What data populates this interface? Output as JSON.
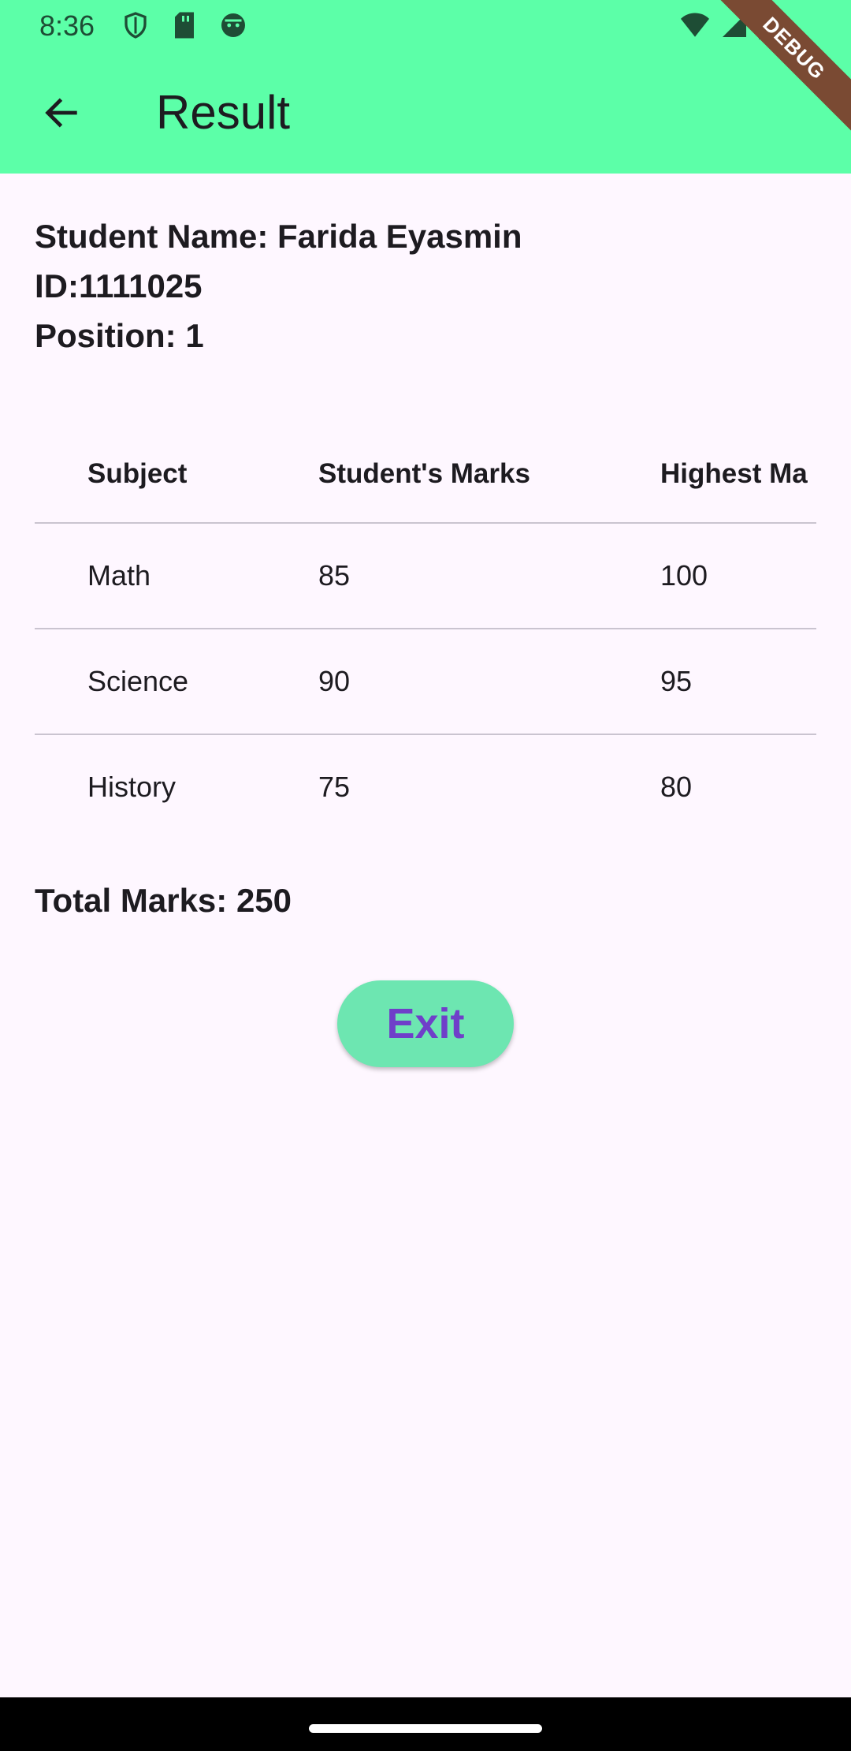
{
  "status_bar": {
    "time": "8:36"
  },
  "app_bar": {
    "title": "Result",
    "debug_banner": "DEBUG"
  },
  "student": {
    "name_line": "Student Name: Farida Eyasmin",
    "id_line": "ID:1111025",
    "position_line": "Position: 1"
  },
  "table": {
    "headers": [
      "Subject",
      "Student's Marks",
      "Highest Ma"
    ],
    "rows": [
      [
        "Math",
        "85",
        "100"
      ],
      [
        "Science",
        "90",
        "95"
      ],
      [
        "History",
        "75",
        "80"
      ]
    ]
  },
  "total_line": "Total Marks: 250",
  "exit_button": "Exit",
  "colors": {
    "app_bar": "#5CFFA8",
    "background": "#FEF7FF",
    "exit_button_bg": "#6DE6B1",
    "exit_button_text": "#6F3FC9"
  }
}
